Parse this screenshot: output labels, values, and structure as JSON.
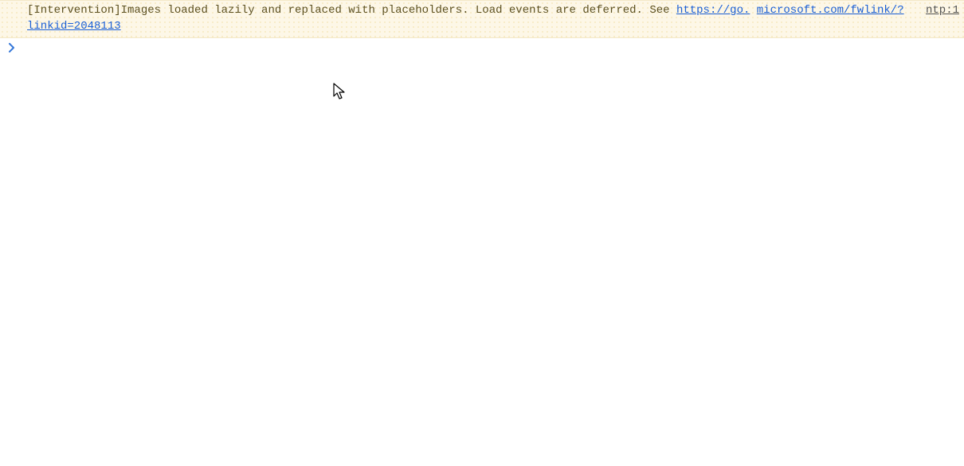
{
  "console": {
    "warning": {
      "prefix": "[Intervention]",
      "message_part1": "Images loaded lazily and replaced with placeholders. Load events are deferred. See ",
      "link_part1": "https://go.",
      "link_part2": "microsoft.com/fwlink/?linkid=2048113",
      "source": "ntp:1"
    },
    "prompt": {
      "value": ""
    }
  },
  "icons": {
    "prompt_chevron": "chevron-right-icon",
    "cursor": "cursor-arrow-icon"
  }
}
